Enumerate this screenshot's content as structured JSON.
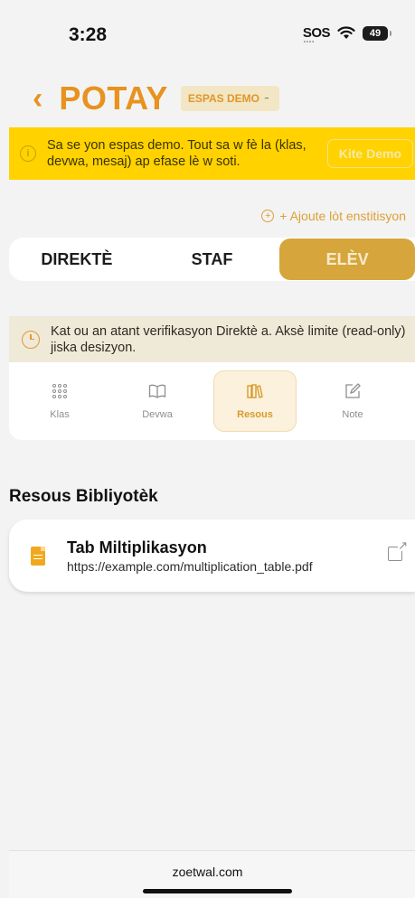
{
  "status": {
    "time": "3:28",
    "sos": "SOS",
    "battery": "49"
  },
  "header": {
    "title": "POTAY",
    "back_icon": "chevron-left-icon",
    "demo_badge": "ESPAS DEMO"
  },
  "demo_banner": {
    "text": "Sa se yon espas demo. Tout sa w fè la (klas, devwa, mesaj) ap efase lè w soti.",
    "exit_label": "Kite Demo"
  },
  "add_institution": "+ Ajoute lòt enstitisyon",
  "role_tabs": [
    {
      "label": "DIREKTÈ"
    },
    {
      "label": "STAF"
    },
    {
      "label": "ELÈV"
    }
  ],
  "verify_banner": {
    "text": "Kat ou an atant verifikasyon Direktè a. Aksè limite (read-only) jiska desizyon."
  },
  "section_tabs": [
    {
      "label": "Klas",
      "icon": "grid-icon"
    },
    {
      "label": "Devwa",
      "icon": "book-icon"
    },
    {
      "label": "Resous",
      "icon": "library-icon"
    },
    {
      "label": "Note",
      "icon": "edit-note-icon"
    }
  ],
  "resources": {
    "heading": "Resous Bibliyotèk",
    "items": [
      {
        "title": "Tab Miltiplikasyon",
        "url": "https://example.com/multiplication_table.pdf"
      }
    ]
  },
  "browser": {
    "domain": "zoetwal.com"
  },
  "colors": {
    "accent": "#e8921f",
    "banner": "#ffd200",
    "active_tab": "#d6a63c"
  }
}
